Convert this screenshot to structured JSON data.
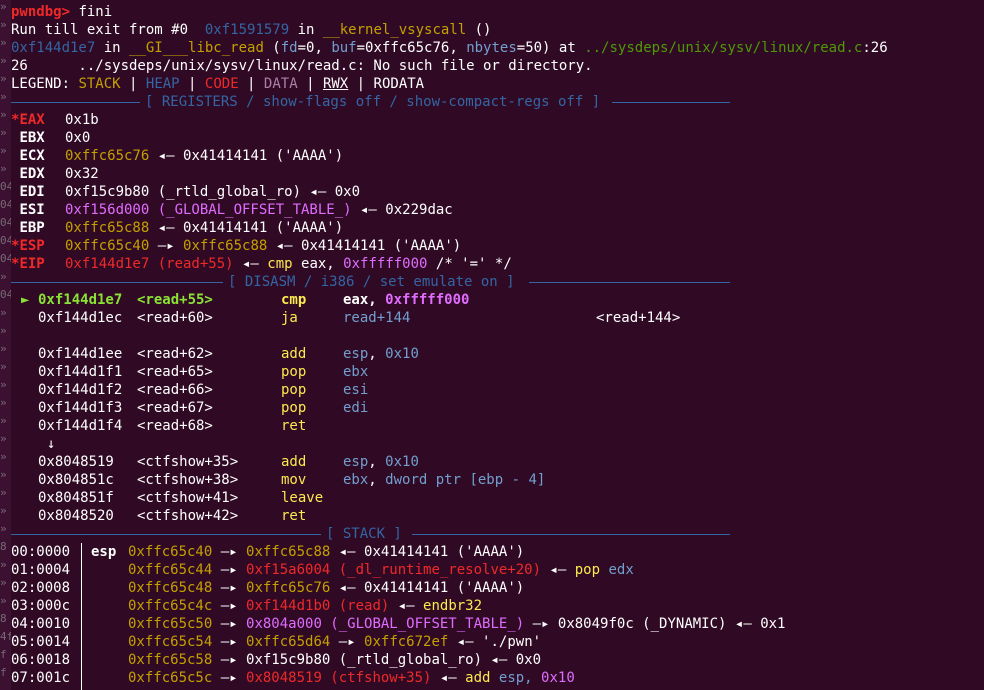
{
  "cmd": {
    "prompt": "pwndbg>",
    "command": "fini"
  },
  "intro": {
    "run_till": "Run till exit from #0  ",
    "frame0_addr": "0xf1591579",
    "in1": " in ",
    "frame0_func": "__kernel_vsyscall",
    "parens": " ()",
    "frame_addr": "0xf144d1e7",
    "in2": " in ",
    "frame_func": "__GI___libc_read",
    "frame_args_open": " (",
    "arg_fd": "fd",
    "eq0": "=0, ",
    "arg_buf": "buf",
    "eq1": "=0xffc65c76, ",
    "arg_nbytes": "nbytes",
    "eq2": "=50) at ",
    "path": "../sysdeps/unix/sysv/linux/read.c",
    "lineno": ":26",
    "err_line": "26      ../sysdeps/unix/sysv/linux/read.c: No such file or directory."
  },
  "legend": {
    "label": "LEGEND: ",
    "stack": "STACK",
    "heap": "HEAP",
    "code": "CODE",
    "data": "DATA",
    "rwx": "RWX",
    "rodata": "RODATA",
    "sep": " | "
  },
  "headers": {
    "registers": "[ REGISTERS / show-flags off / show-compact-regs off ]",
    "disasm": "[ DISASM / i386 / set emulate on ]",
    "stack": "[ STACK ]"
  },
  "registers": {
    "eax": {
      "mark": "*",
      "name": "EAX",
      "val": "0x1b"
    },
    "ebx": {
      "name": "EBX",
      "val": "0x0"
    },
    "ecx": {
      "name": "ECX",
      "val": "0xffc65c76",
      "arrow": " ◂— ",
      "deref": "0x41414141 ('AAAA')"
    },
    "edx": {
      "name": "EDX",
      "val": "0x32"
    },
    "edi": {
      "name": "EDI",
      "val": "0xf15c9b80 (_rtld_global_ro)",
      "arrow": " ◂— ",
      "deref": "0x0"
    },
    "esi": {
      "name": "ESI",
      "val": "0xf156d000 (_GLOBAL_OFFSET_TABLE_)",
      "arrow": " ◂— ",
      "deref": "0x229dac"
    },
    "ebp": {
      "name": "EBP",
      "val": "0xffc65c88",
      "arrow": " ◂— ",
      "deref": "0x41414141 ('AAAA')"
    },
    "esp": {
      "mark": "*",
      "name": "ESP",
      "val": "0xffc65c40",
      "arrow1": " —▸ ",
      "val2": "0xffc65c88",
      "arrow2": " ◂— ",
      "deref": "0x41414141 ('AAAA')"
    },
    "eip": {
      "mark": "*",
      "name": "EIP",
      "val": "0xf144d1e7 (read+55)",
      "arrow": " ◂— ",
      "mn": "cmp",
      "ops": " eax, ",
      "imm": "0xfffff000",
      "cmt": " /* '=' */"
    }
  },
  "disasm": [
    {
      "marker": "►",
      "addr": "0xf144d1e7",
      "sym": "<read+55>",
      "mn": "cmp",
      "op1": "eax",
      "sep": ", ",
      "op2": "0xfffff000",
      "target": ""
    },
    {
      "addr": "0xf144d1ec",
      "sym": "<read+60>",
      "mn": "ja",
      "op1": "read+144",
      "sep": "",
      "op2": "",
      "target": "<read+144>"
    },
    {
      "addr": "0xf144d1ee",
      "sym": "<read+62>",
      "mn": "add",
      "op1": "esp",
      "sep": ", ",
      "op2": "0x10"
    },
    {
      "addr": "0xf144d1f1",
      "sym": "<read+65>",
      "mn": "pop",
      "op1": "ebx",
      "sep": "",
      "op2": ""
    },
    {
      "addr": "0xf144d1f2",
      "sym": "<read+66>",
      "mn": "pop",
      "op1": "esi",
      "sep": "",
      "op2": ""
    },
    {
      "addr": "0xf144d1f3",
      "sym": "<read+67>",
      "mn": "pop",
      "op1": "edi",
      "sep": "",
      "op2": ""
    },
    {
      "addr": "0xf144d1f4",
      "sym": "<read+68>",
      "mn": "ret",
      "op1": "",
      "sep": "",
      "op2": ""
    },
    {
      "addr": "0x8048519",
      "sym": "<ctfshow+35>",
      "mn": "add",
      "op1": "esp",
      "sep": ", ",
      "op2": "0x10"
    },
    {
      "addr": "0x804851c",
      "sym": "<ctfshow+38>",
      "mn": "mov",
      "op1": "ebx",
      "sep": ", ",
      "op2": "dword ptr [ebp - 4]"
    },
    {
      "addr": "0x804851f",
      "sym": "<ctfshow+41>",
      "mn": "leave",
      "op1": "",
      "sep": "",
      "op2": ""
    },
    {
      "addr": "0x8048520",
      "sym": "<ctfshow+42>",
      "mn": "ret",
      "op1": "",
      "sep": "",
      "op2": ""
    }
  ],
  "down_arrow": "↓",
  "stack": [
    {
      "off": "00:0000",
      "reg": "esp",
      "addr": "0xffc65c40",
      "a1": " —▸ ",
      "v1": "0xffc65c88",
      "a2": " ◂— ",
      "v2": "0x41414141 ('AAAA')",
      "a3": "",
      "v3": ""
    },
    {
      "off": "01:0004",
      "reg": "",
      "addr": "0xffc65c44",
      "a1": " —▸ ",
      "v1": "0xf15a6004 (_dl_runtime_resolve+20)",
      "a2": " ◂— ",
      "v2": "pop",
      "a3": " ",
      "v3": "edx"
    },
    {
      "off": "02:0008",
      "reg": "",
      "addr": "0xffc65c48",
      "a1": " —▸ ",
      "v1": "0xffc65c76",
      "a2": " ◂— ",
      "v2": "0x41414141 ('AAAA')",
      "a3": "",
      "v3": ""
    },
    {
      "off": "03:000c",
      "reg": "",
      "addr": "0xffc65c4c",
      "a1": " —▸ ",
      "v1": "0xf144d1b0 (read)",
      "a2": " ◂— ",
      "v2": "endbr32",
      "a3": "",
      "v3": ""
    },
    {
      "off": "04:0010",
      "reg": "",
      "addr": "0xffc65c50",
      "a1": " —▸ ",
      "v1": "0x804a000 (_GLOBAL_OFFSET_TABLE_)",
      "a2": " —▸ ",
      "v2": "0x8049f0c (_DYNAMIC)",
      "a3": " ◂— ",
      "v3": "0x1"
    },
    {
      "off": "05:0014",
      "reg": "",
      "addr": "0xffc65c54",
      "a1": " —▸ ",
      "v1": "0xffc65d64",
      "a2": " —▸ ",
      "v2": "0xffc672ef",
      "a3": " ◂— ",
      "v3": "'./pwn'"
    },
    {
      "off": "06:0018",
      "reg": "",
      "addr": "0xffc65c58",
      "a1": " —▸ ",
      "v1": "0xf15c9b80 (_rtld_global_ro)",
      "a2": " ◂— ",
      "v2": "0x0",
      "a3": "",
      "v3": ""
    },
    {
      "off": "07:001c",
      "reg": "",
      "addr": "0xffc65c5c",
      "a1": " —▸ ",
      "v1": "0x8048519 (ctfshow+35)",
      "a2": " ◂— ",
      "v2": "add",
      "a3": " esp, ",
      "v3": "0x10"
    }
  ],
  "colors": {
    "background": "#300a24",
    "stack": "#c4a000",
    "heap": "#3465a4",
    "code": "#ef2929",
    "data": "#ad7fa8",
    "rule": "#3465a4"
  }
}
